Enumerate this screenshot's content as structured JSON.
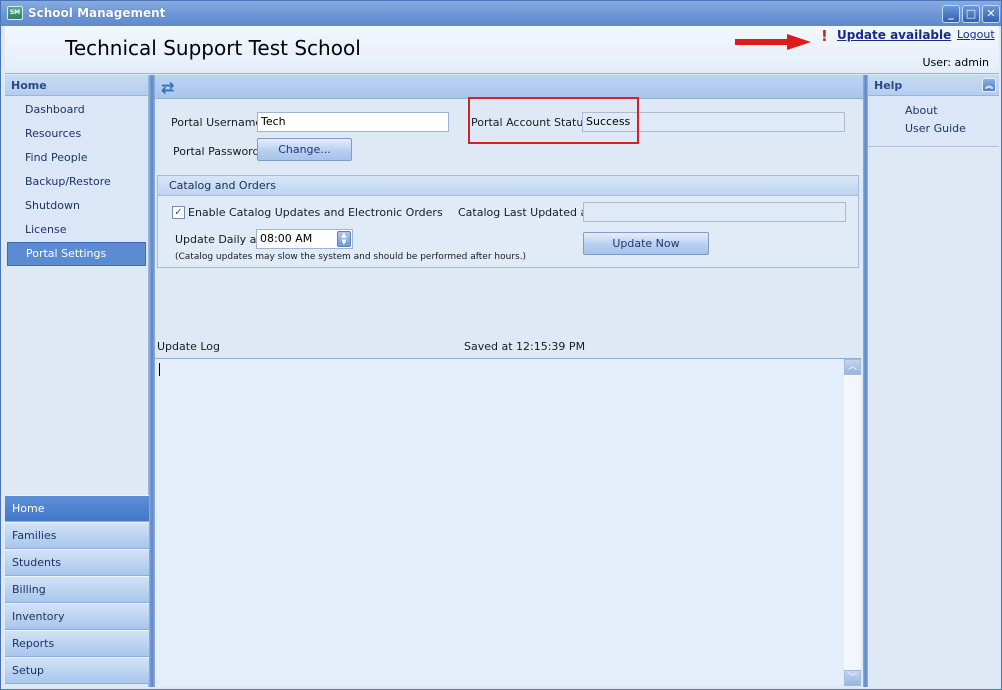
{
  "window": {
    "title": "School Management",
    "app_icon": "app-icon",
    "controls": {
      "minimize": "_",
      "maximize": "□",
      "close": "✕"
    }
  },
  "header": {
    "school_name": "Technical Support Test School",
    "alert_icon": "!",
    "update_link": "Update available",
    "logout_link": "Logout",
    "user_label": "User: admin",
    "annotation_arrow_color": "#e01b1b"
  },
  "left_panel": {
    "heading": "Home",
    "items": [
      {
        "label": "Dashboard",
        "selected": false
      },
      {
        "label": "Resources",
        "selected": false
      },
      {
        "label": "Find People",
        "selected": false
      },
      {
        "label": "Backup/Restore",
        "selected": false
      },
      {
        "label": "Shutdown",
        "selected": false
      },
      {
        "label": "License",
        "selected": false
      },
      {
        "label": "Portal Settings",
        "selected": true
      }
    ],
    "modules": [
      {
        "label": "Home",
        "selected": true
      },
      {
        "label": "Families",
        "selected": false
      },
      {
        "label": "Students",
        "selected": false
      },
      {
        "label": "Billing",
        "selected": false
      },
      {
        "label": "Inventory",
        "selected": false
      },
      {
        "label": "Reports",
        "selected": false
      },
      {
        "label": "Setup",
        "selected": false
      }
    ]
  },
  "main": {
    "refresh_icon": "⇄",
    "portal": {
      "username_label": "Portal Username",
      "username_value": "Tech",
      "password_label": "Portal Password",
      "change_button": "Change...",
      "status_label": "Portal Account Status",
      "status_value": "Success",
      "highlight_color": "#d32127"
    },
    "catalog": {
      "heading": "Catalog and Orders",
      "enable_checked": true,
      "enable_label": "Enable Catalog Updates and Electronic Orders",
      "last_updated_label": "Catalog Last Updated at",
      "last_updated_value": "",
      "update_daily_label": "Update Daily at",
      "update_daily_value": "08:00 AM",
      "update_now_button": "Update Now",
      "note": "(Catalog updates may slow the system and should be performed after hours.)"
    },
    "log": {
      "label": "Update Log",
      "saved_text": "Saved at 12:15:39 PM",
      "content": ""
    }
  },
  "right_panel": {
    "heading": "Help",
    "items": [
      {
        "label": "About"
      },
      {
        "label": "User Guide"
      }
    ]
  }
}
